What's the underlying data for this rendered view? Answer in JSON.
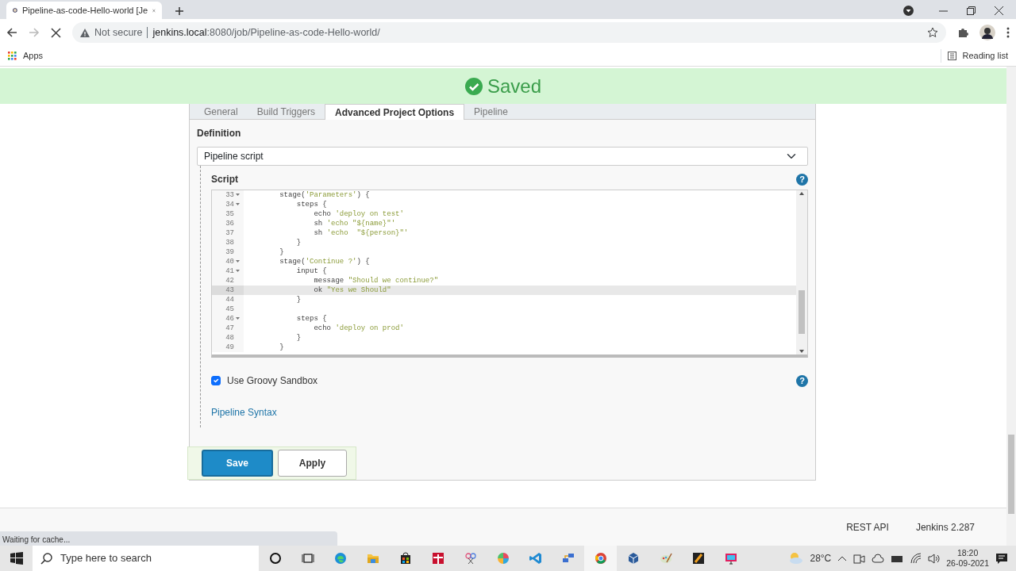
{
  "browser": {
    "tab_title": "Pipeline-as-code-Hello-world [Je",
    "loading": true,
    "security": "Not secure",
    "url_host": "jenkins.local",
    "url_rest": ":8080/job/Pipeline-as-code-Hello-world/",
    "bookmarks": [
      {
        "label": "Apps"
      }
    ],
    "reading_list": "Reading list"
  },
  "banner": {
    "text": "Saved"
  },
  "tabs": [
    {
      "label": "General",
      "selected": false
    },
    {
      "label": "Build Triggers",
      "selected": false
    },
    {
      "label": "Advanced Project Options",
      "selected": true
    },
    {
      "label": "Pipeline",
      "selected": false
    }
  ],
  "definition": {
    "label": "Definition",
    "value": "Pipeline script"
  },
  "script": {
    "label": "Script",
    "help": "?",
    "lines": [
      {
        "number": "33",
        "fold": true,
        "active": false,
        "parts": [
          {
            "text": "        stage(",
            "kind": "code"
          },
          {
            "text": "'Parameters'",
            "kind": "string"
          },
          {
            "text": ") {",
            "kind": "code"
          }
        ]
      },
      {
        "number": "34",
        "fold": true,
        "active": false,
        "parts": [
          {
            "text": "            steps {",
            "kind": "code"
          }
        ]
      },
      {
        "number": "35",
        "fold": false,
        "active": false,
        "parts": [
          {
            "text": "                echo ",
            "kind": "code"
          },
          {
            "text": "'deploy on test'",
            "kind": "string"
          }
        ]
      },
      {
        "number": "36",
        "fold": false,
        "active": false,
        "parts": [
          {
            "text": "                sh ",
            "kind": "code"
          },
          {
            "text": "'echo \"${name}\"'",
            "kind": "string"
          }
        ]
      },
      {
        "number": "37",
        "fold": false,
        "active": false,
        "parts": [
          {
            "text": "                sh ",
            "kind": "code"
          },
          {
            "text": "'echo  \"${person}\"'",
            "kind": "string"
          }
        ]
      },
      {
        "number": "38",
        "fold": false,
        "active": false,
        "parts": [
          {
            "text": "            }",
            "kind": "code"
          }
        ]
      },
      {
        "number": "39",
        "fold": false,
        "active": false,
        "parts": [
          {
            "text": "        }",
            "kind": "code"
          }
        ]
      },
      {
        "number": "40",
        "fold": true,
        "active": false,
        "parts": [
          {
            "text": "        stage(",
            "kind": "code"
          },
          {
            "text": "'Continue ?'",
            "kind": "string"
          },
          {
            "text": ") {",
            "kind": "code"
          }
        ]
      },
      {
        "number": "41",
        "fold": true,
        "active": false,
        "parts": [
          {
            "text": "            input {",
            "kind": "code"
          }
        ]
      },
      {
        "number": "42",
        "fold": false,
        "active": false,
        "parts": [
          {
            "text": "                message ",
            "kind": "code"
          },
          {
            "text": "\"Should we continue?\"",
            "kind": "string"
          }
        ]
      },
      {
        "number": "43",
        "fold": false,
        "active": true,
        "parts": [
          {
            "text": "                ok ",
            "kind": "code"
          },
          {
            "text": "\"Yes we Should\"",
            "kind": "string"
          }
        ]
      },
      {
        "number": "44",
        "fold": false,
        "active": false,
        "parts": [
          {
            "text": "            }",
            "kind": "code"
          }
        ]
      },
      {
        "number": "45",
        "fold": false,
        "active": false
      },
      {
        "number": "46",
        "fold": true,
        "active": false,
        "parts": [
          {
            "text": "            steps {",
            "kind": "code"
          }
        ]
      },
      {
        "number": "47",
        "fold": false,
        "active": false,
        "parts": [
          {
            "text": "                echo ",
            "kind": "code"
          },
          {
            "text": "'deploy on prod'",
            "kind": "string"
          }
        ]
      },
      {
        "number": "48",
        "fold": false,
        "active": false,
        "parts": [
          {
            "text": "            }",
            "kind": "code"
          }
        ]
      },
      {
        "number": "49",
        "fold": false,
        "active": false,
        "parts": [
          {
            "text": "        }",
            "kind": "code"
          }
        ]
      }
    ]
  },
  "sandbox": {
    "label": "Use Groovy Sandbox",
    "checked": true,
    "help": "?"
  },
  "syntax_link": "Pipeline Syntax",
  "buttons": [
    {
      "label": "Save",
      "kind": "primary"
    },
    {
      "label": "Apply",
      "kind": "secondary"
    }
  ],
  "footer": {
    "links": [
      "REST API",
      "Jenkins 2.287"
    ]
  },
  "status": "Waiting for cache...",
  "taskbar": {
    "search_placeholder": "Type here to search",
    "weather": "28°C",
    "time": "18:20",
    "date": "26-09-2021"
  }
}
